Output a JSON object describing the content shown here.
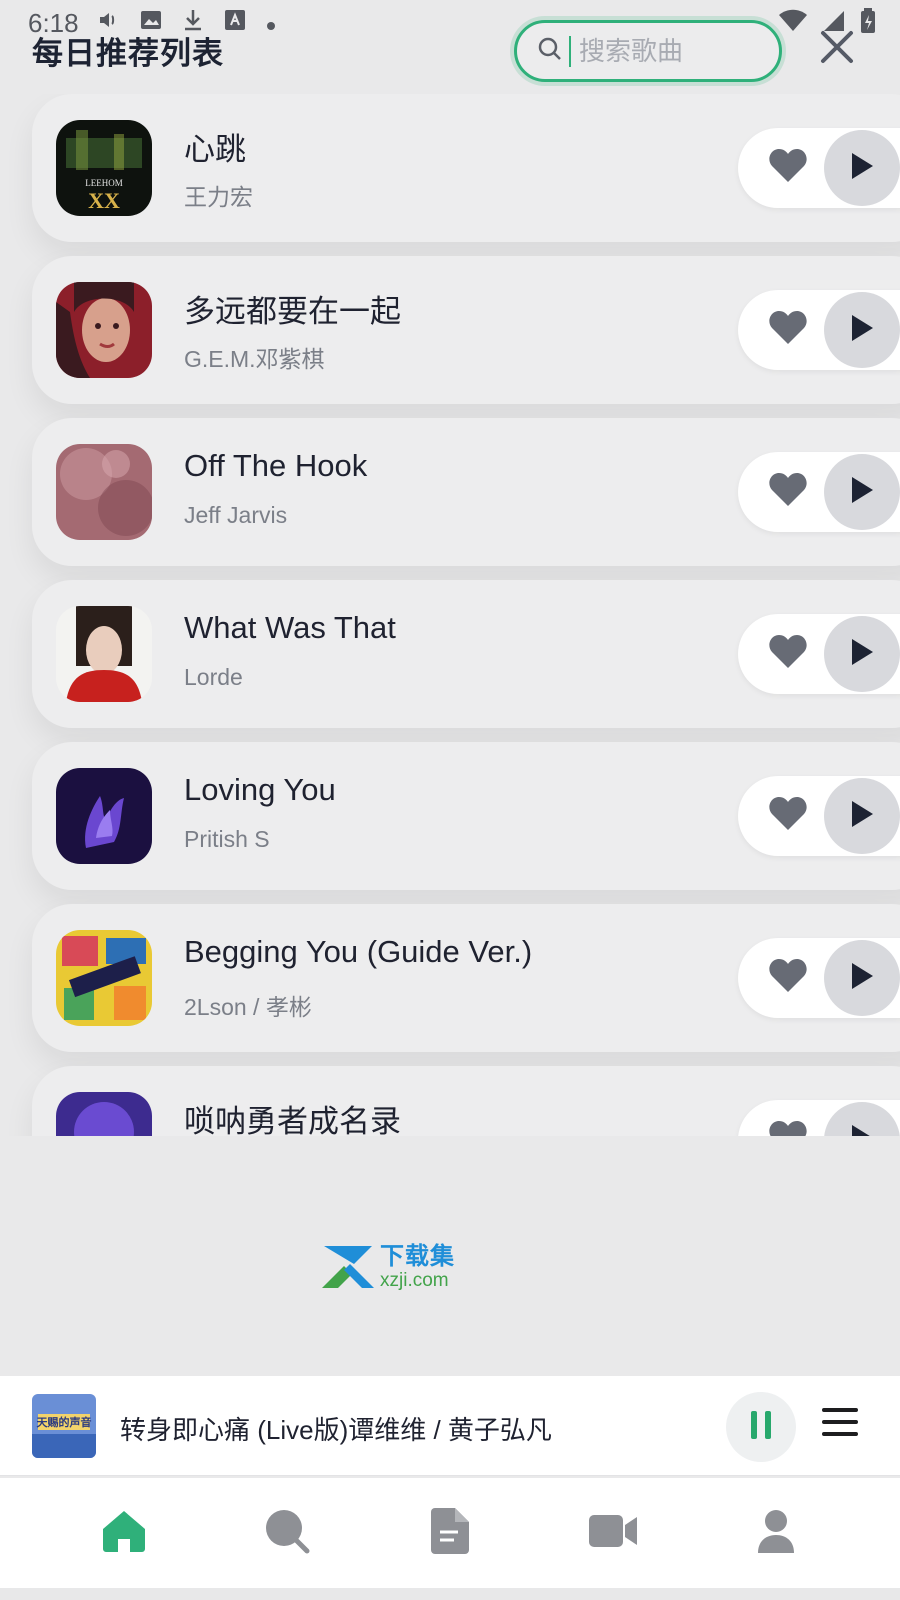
{
  "status_bar": {
    "time": "6:18",
    "icons": [
      "volume-icon",
      "image-icon",
      "download-icon",
      "font-icon",
      "dot-icon",
      "wifi-icon",
      "signal-icon",
      "battery-icon"
    ]
  },
  "header": {
    "title": "每日推荐列表",
    "search_placeholder": "搜索歌曲",
    "search_value": ""
  },
  "songs": [
    {
      "title": "心跳",
      "artist": "王力宏",
      "cover_colors": [
        "#0e120e",
        "#3b5c2d",
        "#d8b24a"
      ]
    },
    {
      "title": "多远都要在一起",
      "artist": "G.E.M.邓紫棋",
      "cover_colors": [
        "#8c1f2a",
        "#d7a08c",
        "#3a1a1f"
      ]
    },
    {
      "title": "Off The Hook",
      "artist": "Jeff Jarvis",
      "cover_colors": [
        "#a46a72",
        "#c8959b",
        "#7d4450"
      ]
    },
    {
      "title": "What Was That",
      "artist": "Lorde",
      "cover_colors": [
        "#f3f3f1",
        "#c7211e",
        "#2b1f1b"
      ]
    },
    {
      "title": "Loving You",
      "artist": "Pritish S",
      "cover_colors": [
        "#1b1040",
        "#6a47d0",
        "#0c0620"
      ]
    },
    {
      "title": "Begging You (Guide Ver.)",
      "artist": "2Lson / 孝彬",
      "cover_colors": [
        "#e9c934",
        "#d84a57",
        "#2d6fb4"
      ]
    },
    {
      "title": "唢呐勇者成名录",
      "artist": "",
      "cover_colors": [
        "#3d2b8f",
        "#ffffff",
        "#6a4bd1"
      ]
    }
  ],
  "watermark": {
    "cn": "下载集",
    "en": "xzji.com"
  },
  "mini_player": {
    "title": "转身即心痛 (Live版)谭维维 / 黄子弘凡",
    "cover_text": "天赐的声音"
  },
  "bottom_nav": [
    {
      "name": "home",
      "active": true
    },
    {
      "name": "search",
      "active": false
    },
    {
      "name": "document",
      "active": false
    },
    {
      "name": "video",
      "active": false
    },
    {
      "name": "profile",
      "active": false
    }
  ],
  "colors": {
    "accent": "#2fb07a",
    "active_nav": "#2fb07a",
    "inactive_nav": "#8e9095",
    "card_bg": "#ededee",
    "play_bg": "#d8d9dd"
  }
}
